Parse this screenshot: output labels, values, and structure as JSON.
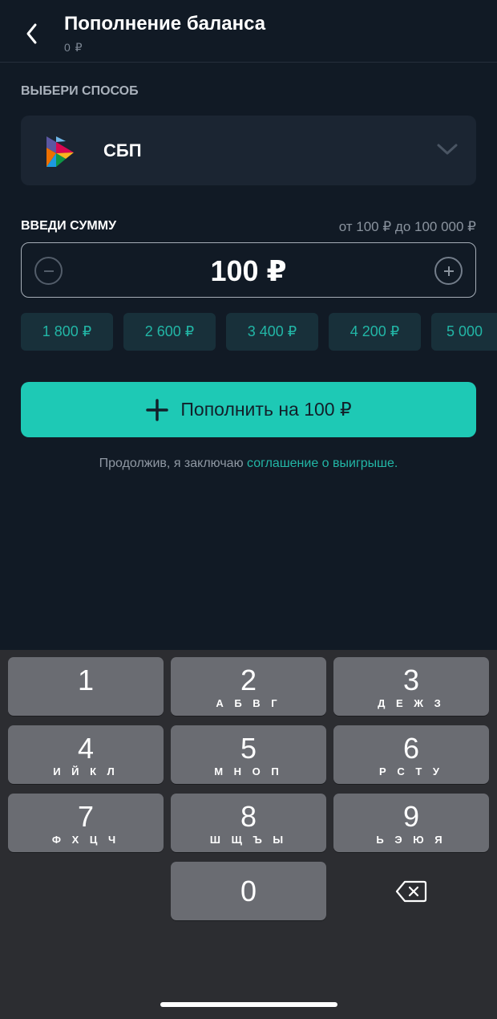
{
  "header": {
    "title": "Пополнение баланса",
    "balance": "0 ₽"
  },
  "method": {
    "label": "ВЫБЕРИ СПОСОБ",
    "selected": "СБП"
  },
  "amount": {
    "label": "ВВЕДИ СУММУ",
    "range": "от 100 ₽ до 100 000 ₽",
    "value": "100 ₽"
  },
  "quick_amounts": [
    "1 800 ₽",
    "2 600 ₽",
    "3 400 ₽",
    "4 200 ₽",
    "5 000"
  ],
  "submit": {
    "label": "Пополнить на 100 ₽"
  },
  "agreement": {
    "text": "Продолжив, я заключаю ",
    "link": "соглашение о выигрыше."
  },
  "keypad": {
    "keys": [
      {
        "num": "1",
        "letters": ""
      },
      {
        "num": "2",
        "letters": "А Б В Г"
      },
      {
        "num": "3",
        "letters": "Д Е Ж З"
      },
      {
        "num": "4",
        "letters": "И Й К Л"
      },
      {
        "num": "5",
        "letters": "М Н О П"
      },
      {
        "num": "6",
        "letters": "Р С Т У"
      },
      {
        "num": "7",
        "letters": "Ф Х Ц Ч"
      },
      {
        "num": "8",
        "letters": "Ш Щ Ъ Ы"
      },
      {
        "num": "9",
        "letters": "Ь Э Ю Я"
      },
      {
        "num": "0",
        "letters": ""
      }
    ]
  },
  "colors": {
    "background": "#111a25",
    "accent": "#1ec9b5",
    "chip_text": "#22b6a6",
    "panel": "#1b2532",
    "keyboard": "#2c2d31",
    "key": "#6a6c72"
  }
}
